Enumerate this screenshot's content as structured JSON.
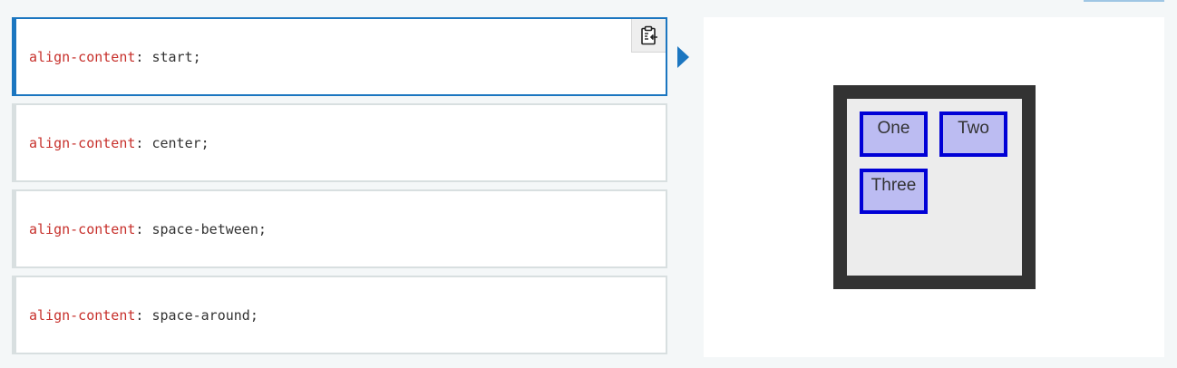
{
  "choices": [
    {
      "property": "align-content",
      "value": "start",
      "selected": true
    },
    {
      "property": "align-content",
      "value": "center",
      "selected": false
    },
    {
      "property": "align-content",
      "value": "space-between",
      "selected": false
    },
    {
      "property": "align-content",
      "value": "space-around",
      "selected": false
    }
  ],
  "punctuation": {
    "colon": ": ",
    "semicolon": ";"
  },
  "copy_button": {
    "icon": "clipboard-icon"
  },
  "output": {
    "items": [
      "One",
      "Two",
      "Three"
    ]
  },
  "colors": {
    "accent": "#1b76c0",
    "property": "#c7302b",
    "item_fill": "#bcbcf2",
    "item_border": "#0000d6",
    "container_border": "#333333"
  }
}
